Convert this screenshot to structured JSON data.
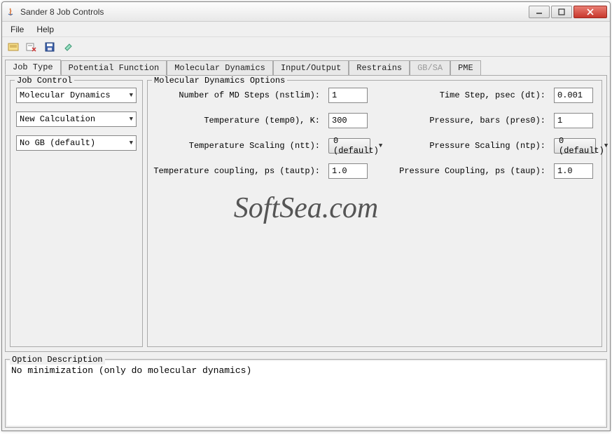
{
  "window": {
    "title": "Sander 8 Job Controls"
  },
  "menubar": {
    "file": "File",
    "help": "Help"
  },
  "tabs": {
    "job_type": "Job Type",
    "potential": "Potential Function",
    "mol_dyn": "Molecular Dynamics",
    "io": "Input/Output",
    "restrains": "Restrains",
    "gbsa": "GB/SA",
    "pme": "PME"
  },
  "job_control": {
    "legend": "Job Control",
    "select1": "Molecular Dynamics",
    "select2": "New Calculation",
    "select3": "No GB (default)"
  },
  "mol_options": {
    "legend": "Molecular Dynamics Options",
    "nstlim_label": "Number of MD Steps (nstlim):",
    "nstlim_value": "1",
    "dt_label": "Time Step, psec (dt):",
    "dt_value": "0.001",
    "temp0_label": "Temperature (temp0), K:",
    "temp0_value": "300",
    "pres0_label": "Pressure, bars (pres0):",
    "pres0_value": "1",
    "ntt_label": "Temperature Scaling (ntt):",
    "ntt_value": "0 (default)",
    "ntp_label": "Pressure Scaling (ntp):",
    "ntp_value": "0 (default)",
    "tautp_label": "Temperature coupling, ps (tautp):",
    "tautp_value": "1.0",
    "taup_label": "Pressure Coupling, ps (taup):",
    "taup_value": "1.0"
  },
  "watermark": "SoftSea.com",
  "option_desc": {
    "legend": "Option Description",
    "text": "No minimization (only do molecular dynamics)"
  }
}
